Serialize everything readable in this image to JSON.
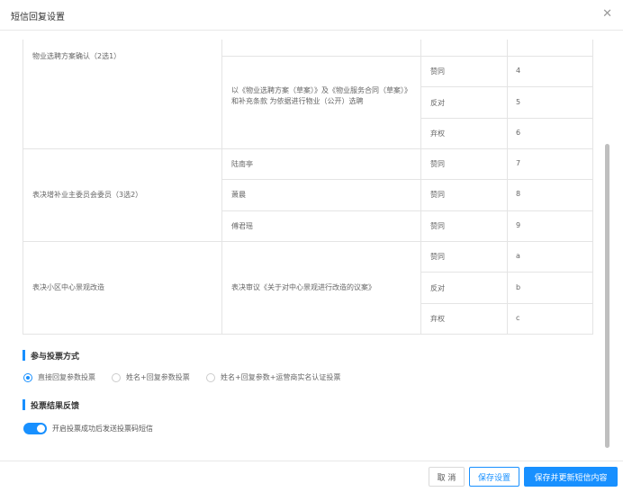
{
  "modal": {
    "title": "短信回复设置"
  },
  "table": {
    "rows": [
      {
        "topic": "物业选聘方案确认（2选1）",
        "item": "以《物业选聘方案（草案）》及《物业服务合同（草案）》和补充条款 为依据进行物业（公开）选聘",
        "options": [
          {
            "choice": "赞同",
            "code": "4"
          },
          {
            "choice": "反对",
            "code": "5"
          },
          {
            "choice": "弃权",
            "code": "6"
          }
        ]
      },
      {
        "topic": "表决增补业主委员会委员（3选2）",
        "candidates": [
          {
            "name": "陆南亭",
            "choice": "赞同",
            "code": "7"
          },
          {
            "name": "萧晨",
            "choice": "赞同",
            "code": "8"
          },
          {
            "name": "傅君瑶",
            "choice": "赞同",
            "code": "9"
          }
        ]
      },
      {
        "topic": "表决小区中心景观改造",
        "item": "表决审议《关于对中心景观进行改造的议案》",
        "options": [
          {
            "choice": "赞同",
            "code": "a"
          },
          {
            "choice": "反对",
            "code": "b"
          },
          {
            "choice": "弃权",
            "code": "c"
          }
        ]
      }
    ]
  },
  "vote_method": {
    "title": "参与投票方式",
    "options": [
      {
        "label": "直接回复参数投票",
        "selected": true
      },
      {
        "label": "姓名+回复参数投票",
        "selected": false
      },
      {
        "label": "姓名+回复参数+运营商实名认证投票",
        "selected": false
      }
    ]
  },
  "feedback": {
    "title": "投票结果反馈",
    "switch_label": "开启投票成功后发送投票码短信",
    "switch_on": true
  },
  "footer": {
    "cancel": "取 消",
    "save": "保存设置",
    "save_update": "保存并更新短信内容"
  },
  "colors": {
    "accent": "#1890ff"
  },
  "icons": {
    "close": "close-icon"
  }
}
